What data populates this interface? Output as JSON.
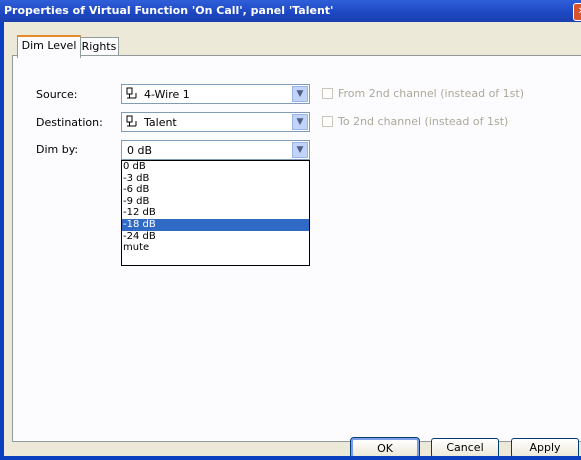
{
  "window": {
    "title": "Properties of Virtual Function 'On Call', panel 'Talent'",
    "close_glyph": "✕"
  },
  "tabs": [
    {
      "label": "Dim Level"
    },
    {
      "label": "Rights"
    }
  ],
  "form": {
    "source": {
      "label": "Source:",
      "value": "4-Wire 1",
      "icon": "device-icon"
    },
    "destination": {
      "label": "Destination:",
      "value": "Talent",
      "icon": "device-icon"
    },
    "dim_by": {
      "label": "Dim by:",
      "value": "0 dB"
    },
    "from2nd": {
      "label": "From 2nd channel (instead of 1st)",
      "checked": false,
      "enabled": false
    },
    "to2nd": {
      "label": "To 2nd channel (instead of 1st)",
      "checked": false,
      "enabled": false
    }
  },
  "dropdown": {
    "options": [
      "0 dB",
      "-3 dB",
      "-6 dB",
      "-9 dB",
      "-12 dB",
      "-18 dB",
      "-24 dB",
      "mute"
    ],
    "highlighted": "-18 dB"
  },
  "buttons": {
    "ok": "OK",
    "cancel": "Cancel",
    "apply": "Apply"
  },
  "glyphs": {
    "arrow": "▼",
    "device": "🖧"
  },
  "colors": {
    "title_bar": "#1d47c2",
    "highlight": "#316ac5",
    "tab_accent": "#e68b2c"
  }
}
